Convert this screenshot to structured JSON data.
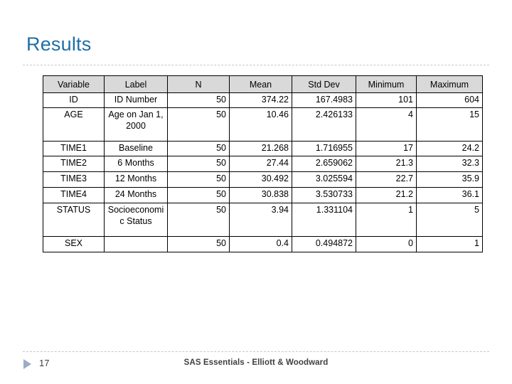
{
  "slide": {
    "title": "Results",
    "accent_color": "#1F6FA8",
    "rule_color": "#C9C9C9"
  },
  "table": {
    "header_background": "#D9D9D9",
    "columns": [
      "Variable",
      "Label",
      "N",
      "Mean",
      "Std Dev",
      "Minimum",
      "Maximum"
    ],
    "rows": [
      {
        "variable": "ID",
        "label": "ID Number",
        "n": "50",
        "mean": "374.22",
        "std_dev": "167.4983",
        "minimum": "101",
        "maximum": "604"
      },
      {
        "variable": "AGE",
        "label": "Age on Jan 1, 2000",
        "n": "50",
        "mean": "10.46",
        "std_dev": "2.426133",
        "minimum": "4",
        "maximum": "15"
      },
      {
        "variable": "TIME1",
        "label": "Baseline",
        "n": "50",
        "mean": "21.268",
        "std_dev": "1.716955",
        "minimum": "17",
        "maximum": "24.2"
      },
      {
        "variable": "TIME2",
        "label": "6 Months",
        "n": "50",
        "mean": "27.44",
        "std_dev": "2.659062",
        "minimum": "21.3",
        "maximum": "32.3"
      },
      {
        "variable": "TIME3",
        "label": "12 Months",
        "n": "50",
        "mean": "30.492",
        "std_dev": "3.025594",
        "minimum": "22.7",
        "maximum": "35.9"
      },
      {
        "variable": "TIME4",
        "label": "24 Months",
        "n": "50",
        "mean": "30.838",
        "std_dev": "3.530733",
        "minimum": "21.2",
        "maximum": "36.1"
      },
      {
        "variable": "STATUS",
        "label": "Socioeconomic Status",
        "n": "50",
        "mean": "3.94",
        "std_dev": "1.331104",
        "minimum": "1",
        "maximum": "5"
      },
      {
        "variable": "SEX",
        "label": "",
        "n": "50",
        "mean": "0.4",
        "std_dev": "0.494872",
        "minimum": "0",
        "maximum": "1"
      }
    ]
  },
  "footer": {
    "page_number": "17",
    "center_text": "SAS Essentials - Elliott & Woodward",
    "triangle_icon": "triangle-right-icon",
    "triangle_color": "#9BACC8",
    "text_color": "#3F3F3F"
  }
}
